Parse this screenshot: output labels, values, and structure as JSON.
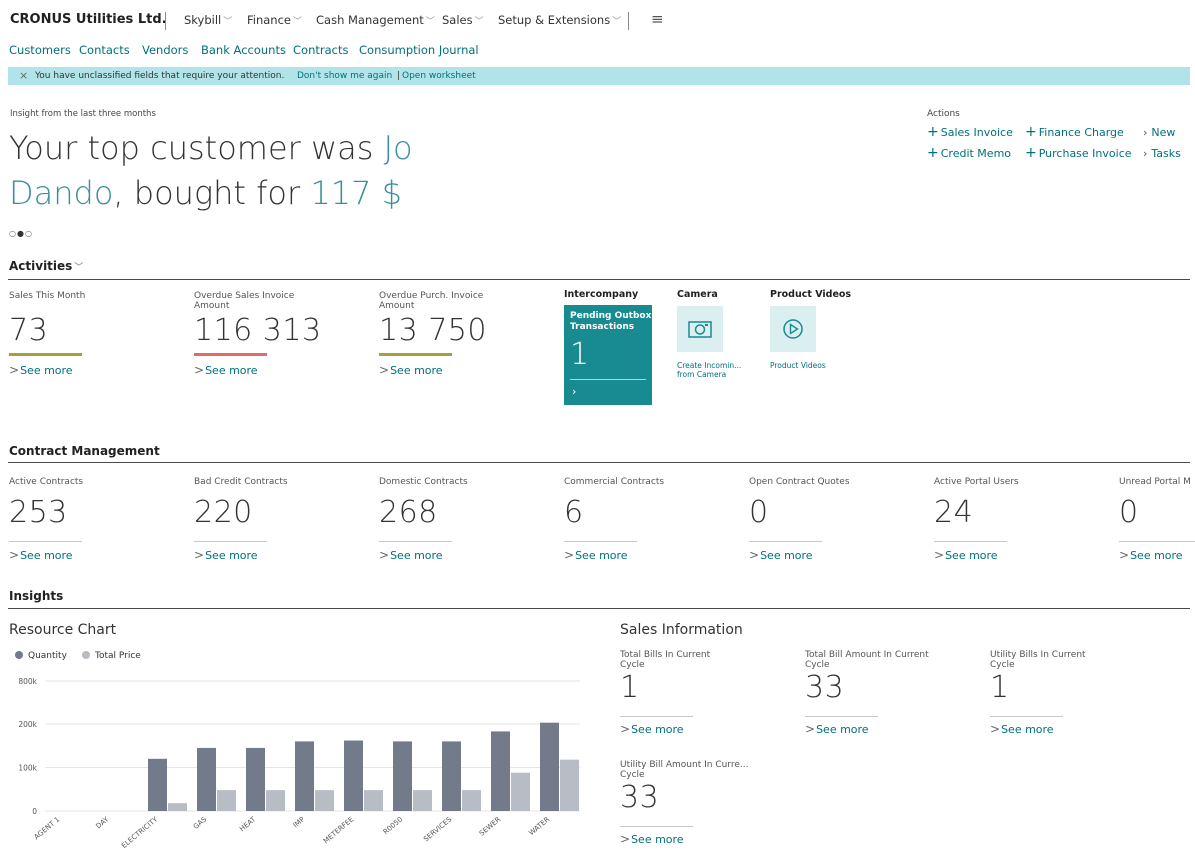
{
  "app": {
    "title": "CRONUS Utilities Ltd."
  },
  "nav": {
    "items": [
      {
        "label": "Skybill"
      },
      {
        "label": "Finance"
      },
      {
        "label": "Cash Management"
      },
      {
        "label": "Sales"
      },
      {
        "label": "Setup & Extensions"
      }
    ],
    "menu_icon": "hamburger-icon"
  },
  "subnav": {
    "items": [
      {
        "label": "Customers"
      },
      {
        "label": "Contacts"
      },
      {
        "label": "Vendors"
      },
      {
        "label": "Bank Accounts"
      },
      {
        "label": "Contracts"
      },
      {
        "label": "Consumption Journal"
      }
    ]
  },
  "notification": {
    "message": "You have unclassified fields that require your attention.",
    "dont_show": "Don't show me again",
    "separator": "|",
    "open_worksheet": "Open worksheet"
  },
  "headline": {
    "caption": "Insight from the last three months",
    "part1": "Your top customer was ",
    "customer": "Jo Dando",
    "part2": ", bought for ",
    "amount": "117 $"
  },
  "actions": {
    "title": "Actions",
    "items": [
      {
        "label": "Sales Invoice",
        "icon": "plus"
      },
      {
        "label": "Finance Charge",
        "icon": "plus"
      },
      {
        "label": "New",
        "icon": "chevron-right"
      },
      {
        "label": "Credit Memo",
        "icon": "plus"
      },
      {
        "label": "Purchase Invoice",
        "icon": "plus"
      },
      {
        "label": "Tasks",
        "icon": "chevron-right"
      }
    ]
  },
  "activities": {
    "title": "Activities",
    "see_more": "See more",
    "cues": [
      {
        "label": "Sales This Month",
        "value": "73",
        "bar_color": "#a89f3b"
      },
      {
        "label": "Overdue Sales Invoice Amount",
        "value": "116 313",
        "bar_color": "#e06b6b"
      },
      {
        "label": "Overdue Purch. Invoice Amount",
        "value": "13 750",
        "bar_color": "#a89f3b"
      }
    ],
    "intercompany": {
      "title": "Intercompany",
      "tile_label": "Pending Outbox Transactions",
      "tile_value": "1",
      "tile_color": "#178b8f"
    },
    "camera": {
      "title": "Camera",
      "caption": "Create Incomin... from Camera",
      "icon": "camera-icon"
    },
    "videos": {
      "title": "Product Videos",
      "caption": "Product Videos",
      "icon": "play-icon"
    }
  },
  "contracts": {
    "title": "Contract Management",
    "see_more": "See more",
    "cues": [
      {
        "label": "Active Contracts",
        "value": "253"
      },
      {
        "label": "Bad Credit Contracts",
        "value": "220"
      },
      {
        "label": "Domestic Contracts",
        "value": "268"
      },
      {
        "label": "Commercial Contracts",
        "value": "6"
      },
      {
        "label": "Open Contract Quotes",
        "value": "0"
      },
      {
        "label": "Active Portal Users",
        "value": "24"
      },
      {
        "label": "Unread Portal M",
        "value": "0"
      }
    ]
  },
  "insights": {
    "title": "Insights"
  },
  "resource_chart": {
    "title": "Resource Chart",
    "colors": {
      "quantity": "#737b8a",
      "total_price": "#b7bcc5"
    }
  },
  "chart_data": {
    "type": "bar",
    "categories": [
      "AGENT 1",
      "DAY",
      "ELECTRICITY",
      "GAS",
      "HEAT",
      "IMP",
      "METERFEE",
      "R0050",
      "SERVICES",
      "SEWER",
      "WATER"
    ],
    "series": [
      {
        "name": "Quantity",
        "values": [
          0,
          0,
          120000,
          145000,
          145000,
          160000,
          162000,
          160000,
          160000,
          183000,
          203000
        ]
      },
      {
        "name": "Total Price",
        "values": [
          0,
          0,
          18000,
          48000,
          48000,
          48000,
          48000,
          48000,
          48000,
          88000,
          118000
        ]
      }
    ],
    "y_ticks": [
      "0",
      "100k",
      "200k",
      "800k"
    ],
    "grid": true,
    "legend": "top-left"
  },
  "sales_info": {
    "title": "Sales Information",
    "see_more": "See more",
    "cues": [
      {
        "label": "Total Bills In Current Cycle",
        "value": "1"
      },
      {
        "label": "Total Bill Amount In Current Cycle",
        "value": "33"
      },
      {
        "label": "Utility Bills In Current Cycle",
        "value": "1"
      },
      {
        "label": "Utility Bill Amount In Curre... Cycle",
        "value": "33"
      }
    ]
  }
}
